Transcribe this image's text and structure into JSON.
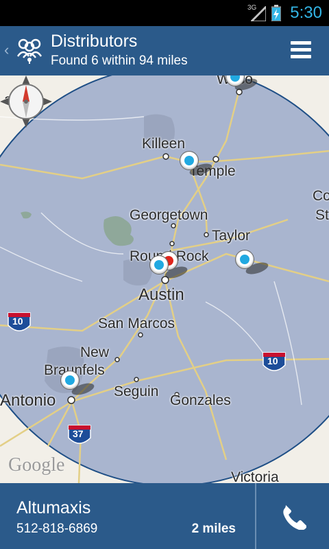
{
  "status_bar": {
    "network": "3G",
    "time": "5:30"
  },
  "header": {
    "title": "Distributors",
    "subtitle": "Found 6 within 94 miles",
    "icon": "distributors-people-icon",
    "menu_icon": "menu-icon"
  },
  "map": {
    "labels": {
      "killeen": "Killeen",
      "temple": "Temple",
      "georgetown": "Georgetown",
      "taylor": "Taylor",
      "round_rock": "Round Rock",
      "austin": "Austin",
      "san_marcos": "San Marcos",
      "new": "New",
      "braunfels": "Braunfels",
      "antonio": "Antonio",
      "seguin": "Seguin",
      "gonzales": "Gonzales",
      "victoria": "Victoria",
      "waco_fragment": "Waco",
      "co_fragment": "Co",
      "st_fragment": "St",
      "a_fragment": "a"
    },
    "highways": [
      "10",
      "10",
      "37"
    ],
    "attribution": "Google",
    "colors": {
      "radius_fill": "#a9b5cf",
      "radius_stroke": "#1f4f86",
      "pin_blue": "#21a9e1",
      "pin_red": "#e0251c"
    }
  },
  "selected_distributor": {
    "name": "Altumaxis",
    "phone": "512-818-6869",
    "distance": "2 miles",
    "call_icon": "phone-icon"
  }
}
